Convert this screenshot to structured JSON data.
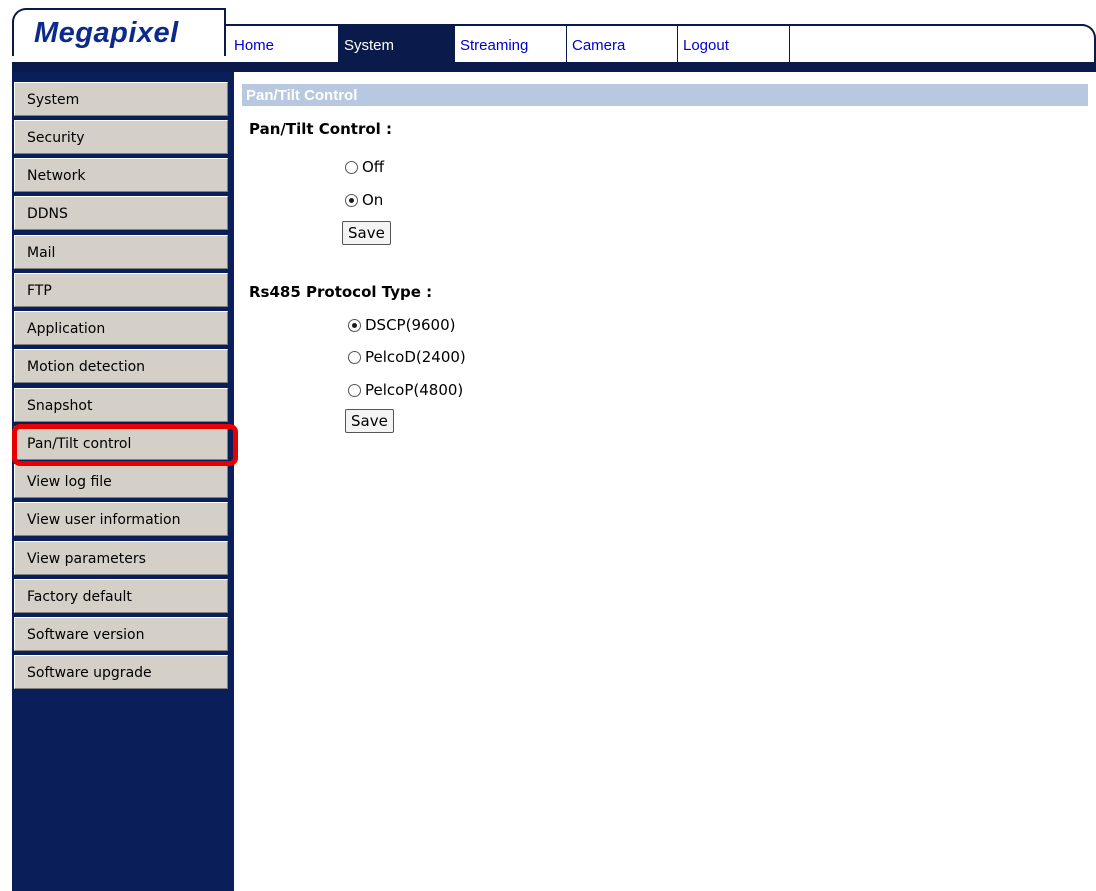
{
  "logo": {
    "text": "Megapixel"
  },
  "nav": {
    "tabs": [
      {
        "label": "Home"
      },
      {
        "label": "System"
      },
      {
        "label": "Streaming"
      },
      {
        "label": "Camera"
      },
      {
        "label": "Logout"
      }
    ],
    "active": "System"
  },
  "sidebar": {
    "items": [
      {
        "label": "System"
      },
      {
        "label": "Security"
      },
      {
        "label": "Network"
      },
      {
        "label": "DDNS"
      },
      {
        "label": "Mail"
      },
      {
        "label": "FTP"
      },
      {
        "label": "Application"
      },
      {
        "label": "Motion detection"
      },
      {
        "label": "Snapshot"
      },
      {
        "label": "Pan/Tilt control"
      },
      {
        "label": "View log file"
      },
      {
        "label": "View user information"
      },
      {
        "label": "View parameters"
      },
      {
        "label": "Factory default"
      },
      {
        "label": "Software version"
      },
      {
        "label": "Software upgrade"
      }
    ],
    "highlighted": "Pan/Tilt control"
  },
  "main": {
    "section_title": "Pan/Tilt Control",
    "pan_tilt": {
      "label": "Pan/Tilt Control :",
      "options": [
        {
          "label": "Off",
          "checked": false
        },
        {
          "label": "On",
          "checked": true
        }
      ],
      "save_label": "Save"
    },
    "rs485": {
      "label": "Rs485 Protocol Type :",
      "options": [
        {
          "label": "DSCP(9600)",
          "checked": true
        },
        {
          "label": "PelcoD(2400)",
          "checked": false
        },
        {
          "label": "PelcoP(4800)",
          "checked": false
        }
      ],
      "save_label": "Save"
    }
  },
  "colors": {
    "navy": "#0a1a4a",
    "logo_blue": "#0b2a8c",
    "section_bar": "#b8c8e0",
    "highlight_red": "#e60000"
  }
}
